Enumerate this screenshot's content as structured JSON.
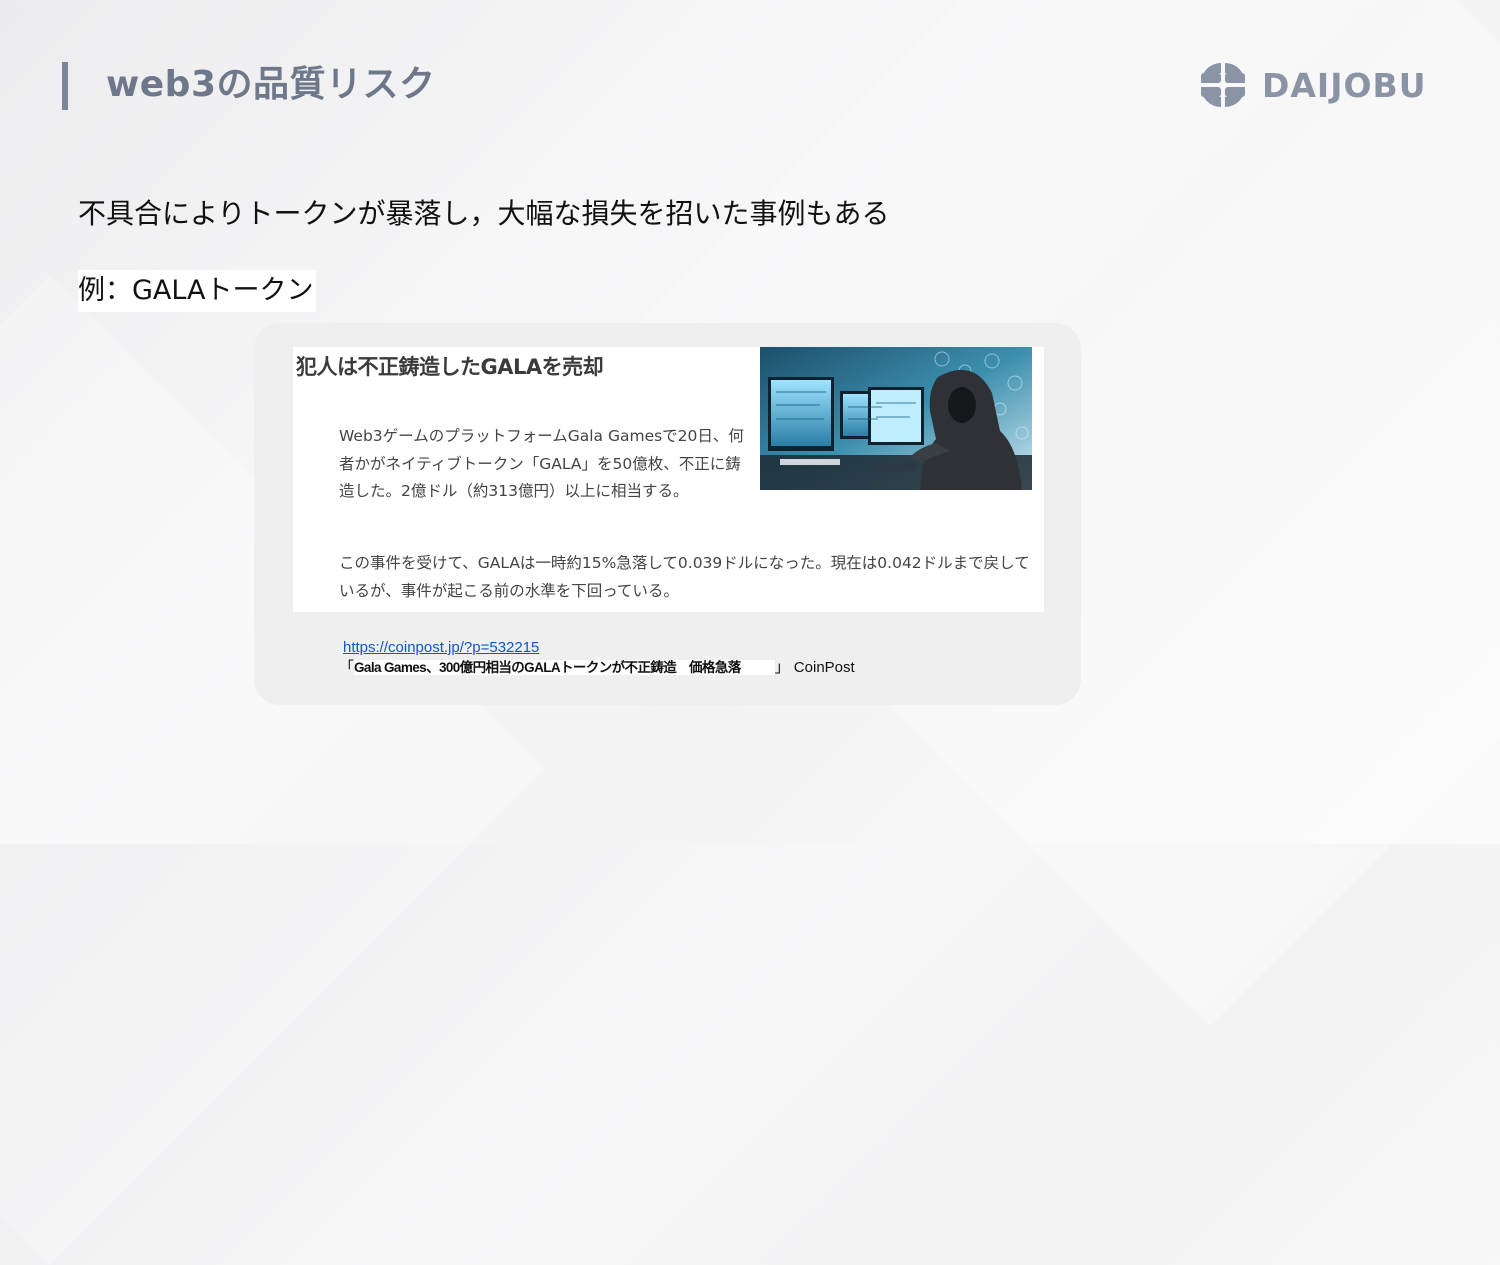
{
  "header": {
    "title": "web3の品質リスク",
    "logo_text": "DAIJOBU",
    "logo_icon": "daijobu-logo-icon"
  },
  "content": {
    "lead": "不具合によりトークンが暴落し，大幅な損失を招いた事例もある",
    "example": "例：GALAトークン"
  },
  "article": {
    "title": "犯人は不正鋳造したGALAを売却",
    "paragraph1": "Web3ゲームのプラットフォームGala Gamesで20日、何者かがネイティブトークン「GALA」を50億枚、不正に鋳造した。2億ドル（約313億円）以上に相当する。",
    "paragraph2": "この事件を受けて、GALAは一時約15%急落して0.039ドルになった。現在は0.042ドルまで戻しているが、事件が起こる前の水準を下回っている。",
    "image_icon": "hacker-at-computer-illustration"
  },
  "source": {
    "url": "https://coinpost.jp/?p=532215",
    "caption_open": "「",
    "article_name": "Gala Games、300億円相当のGALAトークンが不正鋳造　価格急落",
    "caption_close": "」 CoinPost"
  }
}
